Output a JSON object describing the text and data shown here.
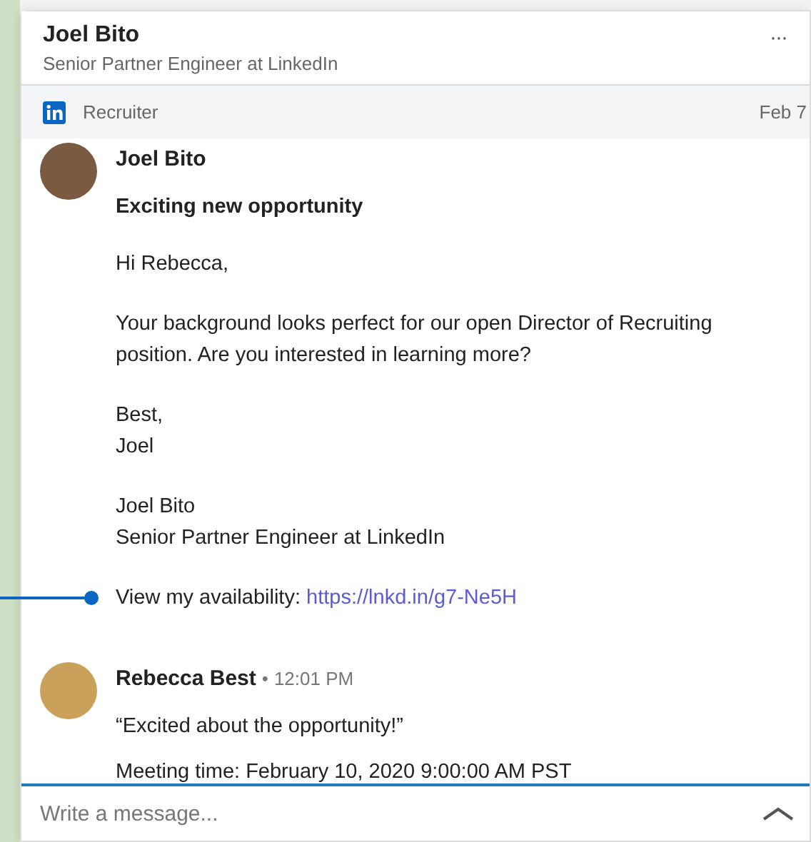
{
  "header": {
    "name": "Joel Bito",
    "subtitle": "Senior Partner Engineer at LinkedIn",
    "more": "···"
  },
  "context_bar": {
    "label": "Recruiter",
    "date": "Feb 7"
  },
  "messages": [
    {
      "kind": "mail",
      "sender": "Joel Bito",
      "subject": "Exciting new opportunity",
      "paragraphs": [
        {
          "lines": [
            "Hi Rebecca,"
          ]
        },
        {
          "lines": [
            "Your background looks perfect for our open Director of Recruiting position. Are you interested in learning more?"
          ]
        },
        {
          "lines": [
            "Best,",
            "Joel"
          ]
        },
        {
          "lines": [
            "Joel Bito",
            "Senior Partner Engineer at LinkedIn"
          ]
        },
        {
          "lines": [
            "View my availability:"
          ],
          "link": "https://lnkd.in/g7-Ne5H"
        }
      ]
    },
    {
      "kind": "reply",
      "sender": "Rebecca Best",
      "separator": "•",
      "time": "12:01 PM",
      "lines": [
        "“Excited about the opportunity!”",
        "Meeting time: February 10, 2020 9:00:00 AM PST"
      ]
    }
  ],
  "composer": {
    "placeholder": "Write a message..."
  }
}
